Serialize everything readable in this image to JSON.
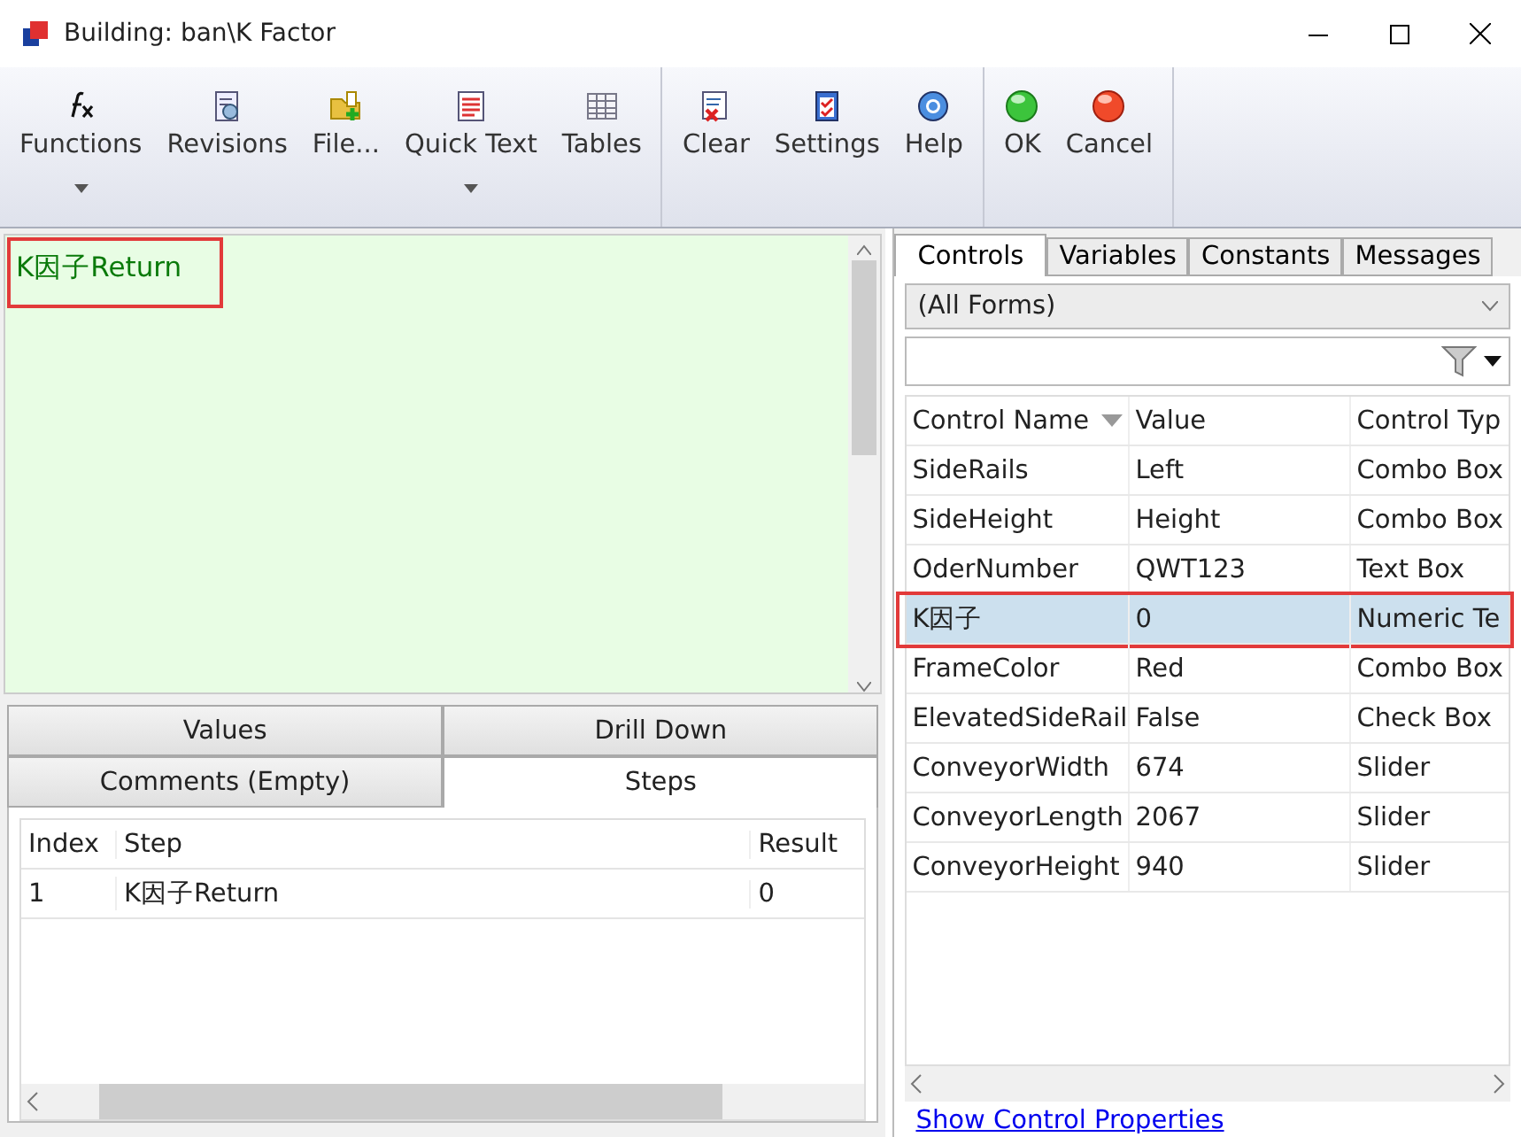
{
  "window": {
    "title": "Building: ban\\K Factor"
  },
  "toolbar": {
    "groups": [
      [
        {
          "label": "Functions",
          "dropdown": true
        },
        {
          "label": "Revisions",
          "dropdown": false
        },
        {
          "label": "File...",
          "dropdown": false
        },
        {
          "label": "Quick Text",
          "dropdown": true
        },
        {
          "label": "Tables",
          "dropdown": false
        }
      ],
      [
        {
          "label": "Clear",
          "dropdown": false
        },
        {
          "label": "Settings",
          "dropdown": false
        },
        {
          "label": "Help",
          "dropdown": false
        }
      ],
      [
        {
          "label": "OK",
          "dropdown": false
        },
        {
          "label": "Cancel",
          "dropdown": false
        }
      ]
    ]
  },
  "editor": {
    "text": "K因子Return",
    "highlighted": true
  },
  "bottom_tabs": [
    [
      {
        "label": "Values",
        "selected": false
      },
      {
        "label": "Drill Down",
        "selected": false
      }
    ],
    [
      {
        "label": "Comments (Empty)",
        "selected": false
      },
      {
        "label": "Steps",
        "selected": true
      }
    ]
  ],
  "steps": {
    "columns": [
      "Index",
      "Step",
      "Result"
    ],
    "rows": [
      [
        "1",
        "K因子Return",
        "0"
      ]
    ]
  },
  "side_tabs": [
    {
      "label": "Controls",
      "selected": true
    },
    {
      "label": "Variables",
      "selected": false
    },
    {
      "label": "Constants",
      "selected": false
    },
    {
      "label": "Messages",
      "selected": false
    }
  ],
  "form_filter": {
    "value": "(All Forms)"
  },
  "grid": {
    "columns": [
      "Control Name",
      "Value",
      "Control Typ"
    ],
    "rows": [
      {
        "cells": [
          "SideRails",
          "Left",
          "Combo Box"
        ],
        "selected": false,
        "highlighted": false
      },
      {
        "cells": [
          "SideHeight",
          "Height",
          "Combo Box"
        ],
        "selected": false,
        "highlighted": false
      },
      {
        "cells": [
          "OderNumber",
          "QWT123",
          "Text Box"
        ],
        "selected": false,
        "highlighted": false
      },
      {
        "cells": [
          "K因子",
          "0",
          "Numeric Te"
        ],
        "selected": true,
        "highlighted": true
      },
      {
        "cells": [
          "FrameColor",
          "Red",
          "Combo Box"
        ],
        "selected": false,
        "highlighted": false
      },
      {
        "cells": [
          "ElevatedSideRail",
          "False",
          "Check Box"
        ],
        "selected": false,
        "highlighted": false
      },
      {
        "cells": [
          "ConveyorWidth",
          "674",
          "Slider"
        ],
        "selected": false,
        "highlighted": false
      },
      {
        "cells": [
          "ConveyorLength",
          "2067",
          "Slider"
        ],
        "selected": false,
        "highlighted": false
      },
      {
        "cells": [
          "ConveyorHeight",
          "940",
          "Slider"
        ],
        "selected": false,
        "highlighted": false
      }
    ]
  },
  "link": "Show Control Properties"
}
